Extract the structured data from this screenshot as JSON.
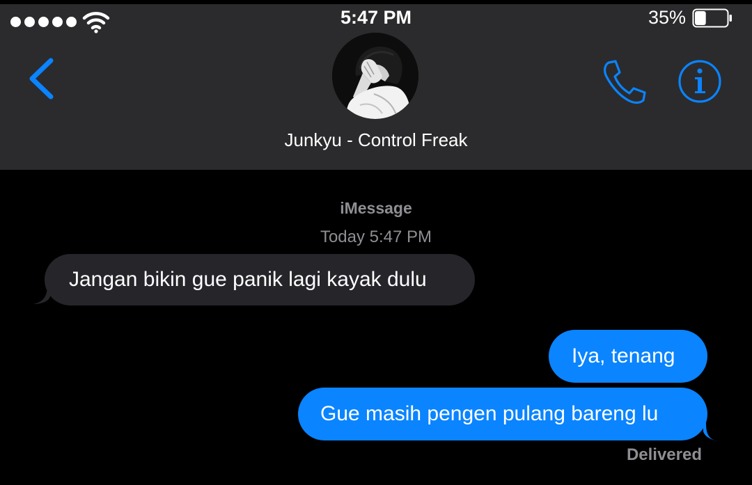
{
  "status_bar": {
    "time": "5:47 PM",
    "battery_percent": "35%",
    "battery_level": 0.35,
    "signal_bars": 5,
    "icons": [
      "signal-dots-icon",
      "wifi-icon",
      "battery-icon"
    ]
  },
  "header": {
    "contact_name": "Junkyu - Control Freak",
    "back_icon": "chevron-left-icon",
    "call_icon": "phone-icon",
    "info_icon": "info-icon"
  },
  "conversation": {
    "service": "iMessage",
    "timestamp": "Today 5:47 PM",
    "messages": [
      {
        "direction": "incoming",
        "text": "Jangan bikin gue panik lagi kayak dulu"
      },
      {
        "direction": "outgoing",
        "text": "Iya, tenang"
      },
      {
        "direction": "outgoing",
        "text": "Gue masih pengen pulang bareng lu"
      }
    ],
    "delivery_status": "Delivered"
  },
  "colors": {
    "header_bg": "#2b2b2d",
    "background": "#000000",
    "accent": "#0a84ff",
    "incoming_bubble": "#26252a",
    "outgoing_bubble": "#0a84ff",
    "secondary_text": "#8e8e93"
  }
}
